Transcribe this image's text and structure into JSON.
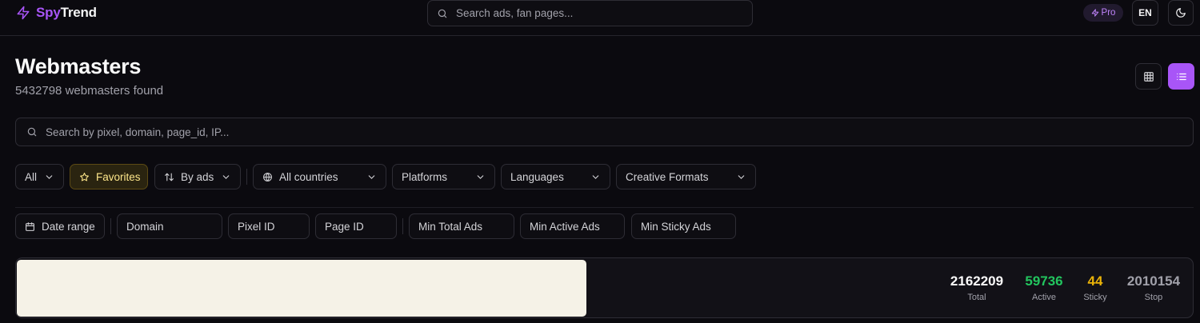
{
  "app": {
    "logo_spy": "Spy",
    "logo_trend": "Trend",
    "search_placeholder": "Search ads, fan pages...",
    "pro_label": "Pro",
    "lang_label": "EN",
    "accent_color": "#a855f7"
  },
  "header": {
    "title": "Webmasters",
    "subtitle": "5432798 webmasters found"
  },
  "search": {
    "placeholder": "Search by pixel, domain, page_id, IP..."
  },
  "filters_row1": {
    "all": "All",
    "favorites": "Favorites",
    "sort": "By ads",
    "countries": "All countries",
    "platforms": "Platforms",
    "languages": "Languages",
    "creative_formats": "Creative Formats"
  },
  "filters_row2": {
    "date_range": "Date range",
    "domain_placeholder": "Domain",
    "pixel_placeholder": "Pixel ID",
    "page_placeholder": "Page ID",
    "min_total_placeholder": "Min Total Ads",
    "min_active_placeholder": "Min Active Ads",
    "min_sticky_placeholder": "Min Sticky Ads"
  },
  "stats": [
    {
      "value": "2162209",
      "label": "Total",
      "color": "#fafafa"
    },
    {
      "value": "59736",
      "label": "Active",
      "color": "#22c55e"
    },
    {
      "value": "44",
      "label": "Sticky",
      "color": "#eab308"
    },
    {
      "value": "2010154",
      "label": "Stop",
      "color": "#a1a1aa"
    }
  ],
  "icons": [
    "zap-icon",
    "search-icon",
    "moon-icon",
    "grid-icon",
    "list-icon",
    "star-icon",
    "sort-icon",
    "globe-icon",
    "calendar-icon",
    "chevron-down-icon"
  ]
}
